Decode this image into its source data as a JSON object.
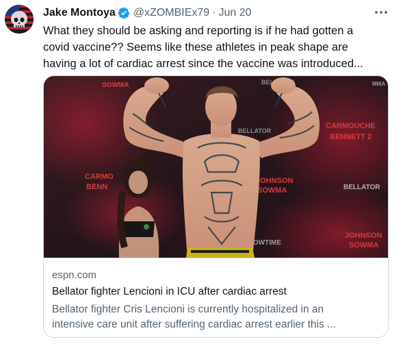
{
  "author": {
    "name": "Jake Montoya",
    "handle": "@xZOMBIEx79",
    "separator": "·",
    "date": "Jun 20",
    "verified": true,
    "avatar_icon": "skull-flag-avatar"
  },
  "tweet": {
    "text_lines": [
      "What they should be asking and reporting is if he had gotten a",
      "covid vaccine?? Seems like these athletes in peak shape are",
      "having a lot of cardiac arrest since the vaccine was introduced..."
    ]
  },
  "card": {
    "image_text": {
      "top_left": "SOWMA",
      "top_right": "BELLATOR",
      "right_1": "CARMOUCHE",
      "right_2": "BENNETT 2",
      "left_1": "CARMO",
      "left_2": "BENN",
      "center": "BELLATOR",
      "mid_right_1": "JOHNSON",
      "mid_right_2": "SOWMA",
      "bottom_right_logo": "BELLATOR",
      "bottom_right_1": "JOHNSON",
      "bottom_right_2": "SOWMA",
      "bottom_center": "SHOWTIME",
      "top_side": "MMA"
    },
    "domain": "espn.com",
    "title": "Bellator fighter Lencioni in ICU after cardiac arrest",
    "description_lines": [
      "Bellator fighter Cris Lencioni is currently hospitalized in an",
      "intensive care unit after suffering cardiac arrest earlier this ..."
    ]
  },
  "colors": {
    "verified_blue": "#1d9bf0",
    "secondary_text": "#536471",
    "border": "#cfd9de"
  }
}
